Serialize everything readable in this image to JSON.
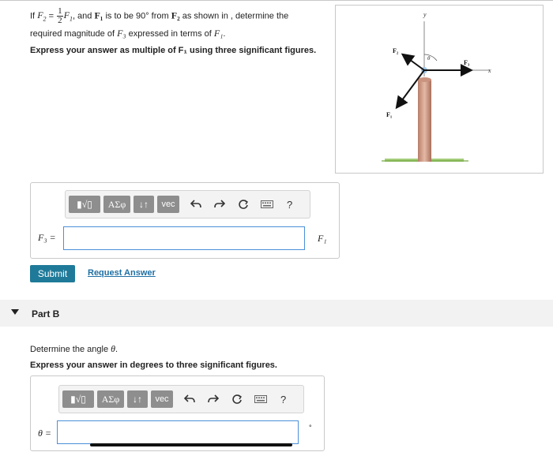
{
  "part_a": {
    "q_if": "If",
    "q_f2_symbol": "F",
    "q_f2_sub": "2",
    "q_equals": "=",
    "q_frac_num": "1",
    "q_frac_den": "2",
    "q_f1_symbol": "F",
    "q_f1_sub": "1",
    "q_and": ", and",
    "q_bold_f1": "F₁",
    "q_mid": "is to be 90° from",
    "q_bold_f2": "F₂",
    "q_end": "as shown in , determine the",
    "q_line2_start": "required magnitude of",
    "q_line2_f3": "F₃",
    "q_line2_mid": "expressed in terms of",
    "q_line2_f1": "F₁",
    "q_line2_end": ".",
    "instruction": "Express your answer as multiple of F₁ using three significant figures.",
    "answer_label": "F₃ =",
    "answer_value": "",
    "unit": "F₁"
  },
  "figure": {
    "label_y": "y",
    "label_x": "x",
    "label_f2": "F₂",
    "label_f3": "F₃",
    "label_f1": "F₁",
    "label_theta": "θ"
  },
  "toolbar": {
    "templates": "▮√▯",
    "greek": "ΑΣφ",
    "arrows": "↓↑",
    "vec": "vec",
    "help": "?"
  },
  "actions": {
    "submit": "Submit",
    "request_answer": "Request Answer"
  },
  "part_b": {
    "title": "Part B",
    "question": "Determine the angle θ.",
    "instruction": "Express your answer in degrees to three significant figures.",
    "answer_label": "θ =",
    "answer_value": "",
    "unit": "°"
  }
}
